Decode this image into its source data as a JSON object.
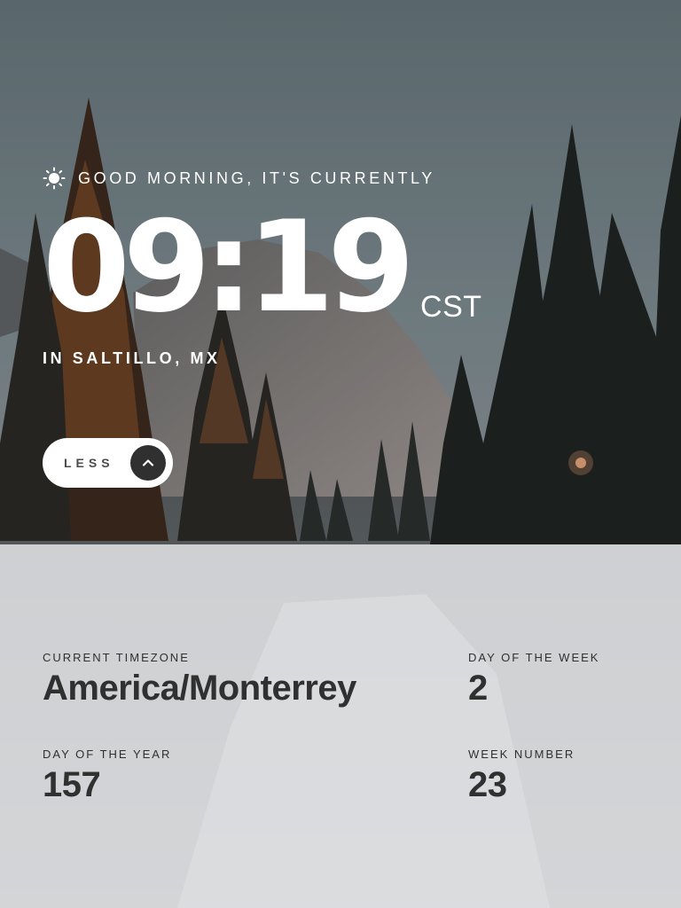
{
  "header": {
    "greeting": "GOOD MORNING, IT'S CURRENTLY",
    "greeting_icon": "sun-icon",
    "time": "09:19",
    "timezone_abbreviation": "CST",
    "location": "IN SALTILLO, MX"
  },
  "toggle_button": {
    "label": "LESS",
    "icon": "chevron-up-icon"
  },
  "details": {
    "current_timezone": {
      "label": "CURRENT TIMEZONE",
      "value": "America/Monterrey"
    },
    "day_of_the_week": {
      "label": "DAY OF THE WEEK",
      "value": "2"
    },
    "day_of_the_year": {
      "label": "DAY OF THE YEAR",
      "value": "157"
    },
    "week_number": {
      "label": "WEEK NUMBER",
      "value": "23"
    }
  },
  "colors": {
    "text_light": "#ffffff",
    "text_dark": "#303030",
    "button_bg": "#ffffff",
    "chevron_circle": "#303030",
    "panel_bg": "#e6e8ea"
  }
}
